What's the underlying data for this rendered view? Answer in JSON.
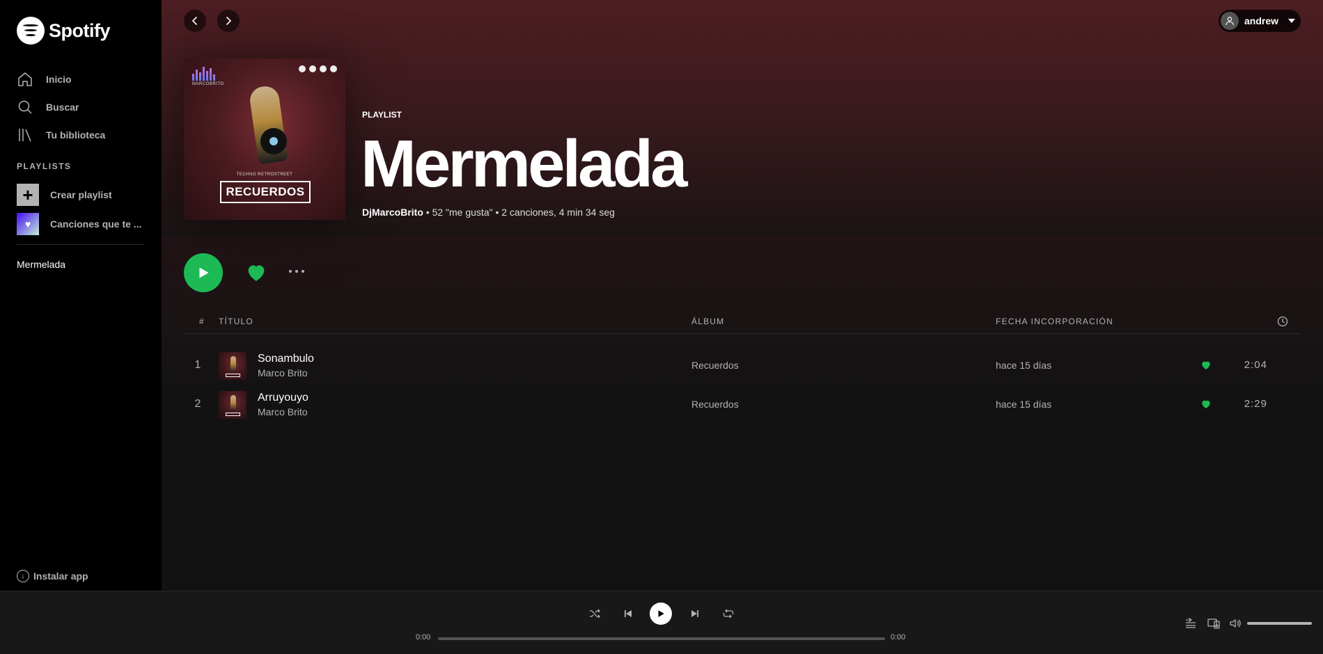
{
  "sidebar": {
    "brand": "Spotify",
    "nav": [
      {
        "label": "Inicio",
        "icon": "home-icon"
      },
      {
        "label": "Buscar",
        "icon": "search-icon"
      },
      {
        "label": "Tu biblioteca",
        "icon": "library-icon"
      }
    ],
    "playlists_heading": "PLAYLISTS",
    "create_playlist": "Crear playlist",
    "liked_songs": "Canciones que te ...",
    "playlists": [
      "Mermelada"
    ],
    "install_app": "Instalar app"
  },
  "topbar": {
    "username": "andrew"
  },
  "playlist": {
    "type_label": "PLAYLIST",
    "title": "Mermelada",
    "owner": "DjMarcoBrito",
    "meta": " • 52 \"me gusta\" • 2 canciones, 4 min 34 seg",
    "cover": {
      "tagline": "TECHNO RETROSTREET",
      "album_text": "RECUERDOS",
      "brand_text": "MARCOBRITO"
    },
    "liked": true
  },
  "table": {
    "col_num": "#",
    "col_title": "TÍTULO",
    "col_album": "ÁLBUM",
    "col_date": "FECHA INCORPORACIÓN",
    "duration_icon": "clock-icon"
  },
  "tracks": [
    {
      "num": "1",
      "title": "Sonambulo",
      "artist": "Marco Brito",
      "album": "Recuerdos",
      "added": "hace 15 días",
      "liked": true,
      "duration": "2:04"
    },
    {
      "num": "2",
      "title": "Arruyouyo",
      "artist": "Marco Brito",
      "album": "Recuerdos",
      "added": "hace 15 días",
      "liked": true,
      "duration": "2:29"
    }
  ],
  "player": {
    "elapsed": "0:00",
    "total": "0:00",
    "progress": 0,
    "volume": 1.0
  },
  "colors": {
    "accent": "#1db954",
    "background": "#121212",
    "sidebar": "#000000",
    "header_gradient": "#4d1e23"
  }
}
